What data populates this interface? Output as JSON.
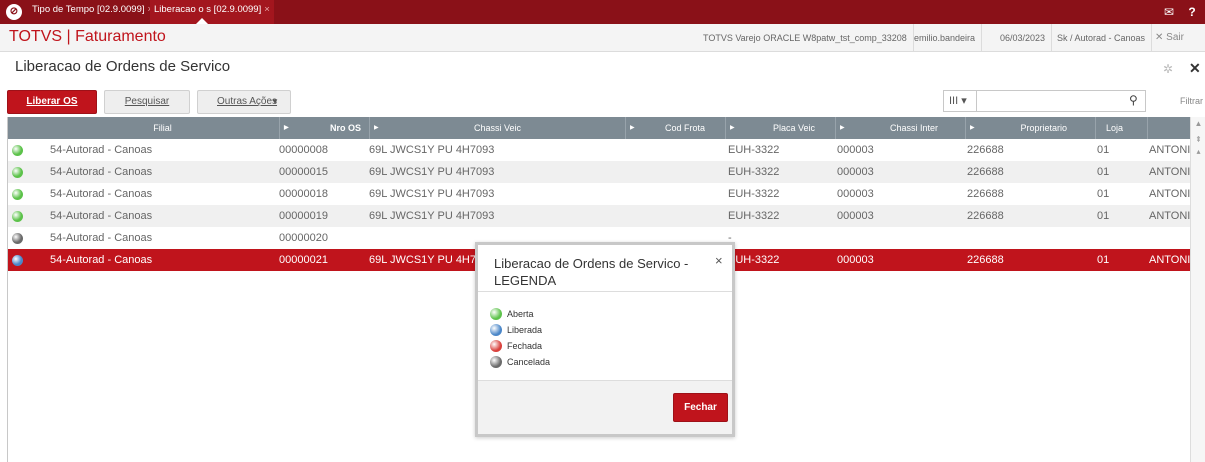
{
  "topbar": {
    "tabs": [
      {
        "label": "Tipo de Tempo [02.9.0099]",
        "close": "×"
      },
      {
        "label": "Liberacao  o s [02.9.0099]",
        "close": "×"
      }
    ],
    "mail_icon": "✉",
    "help_icon": "?"
  },
  "header": {
    "brand": "TOTVS | Faturamento",
    "environment": "TOTVS Varejo ORACLE W8patw_tst_comp_33208",
    "user": "emilio.bandeira",
    "date": "06/03/2023",
    "branch": "Sk / Autorad - Canoas",
    "logout": "✕ Sair"
  },
  "page": {
    "title": "Liberacao de Ordens de Servico"
  },
  "toolbar": {
    "liberar_label": "Liberar OS",
    "pesquisar_label": "Pesquisar",
    "outras_label": "Outras Ações",
    "column_selector": "III ▾",
    "search_value": "",
    "filtrar_label": "Filtrar"
  },
  "grid": {
    "columns": [
      "Filial",
      "Nro OS",
      "Chassi Veic",
      "Cod Frota",
      "Placa Veic",
      "Chassi Inter",
      "Proprietario",
      "Loja",
      ""
    ],
    "rows": [
      {
        "status": "green",
        "filial": "54-Autorad - Canoas",
        "nro_os": "00000008",
        "chassi": "69L JWCS1Y PU 4H7093",
        "cod_frota": "",
        "placa": "EUH-3322",
        "chassi_inter": "000003",
        "proprietario": "226688",
        "loja": "01",
        "nome": "ANTONIO"
      },
      {
        "status": "green",
        "filial": "54-Autorad - Canoas",
        "nro_os": "00000015",
        "chassi": "69L JWCS1Y PU 4H7093",
        "cod_frota": "",
        "placa": "EUH-3322",
        "chassi_inter": "000003",
        "proprietario": "226688",
        "loja": "01",
        "nome": "ANTONIO"
      },
      {
        "status": "green",
        "filial": "54-Autorad - Canoas",
        "nro_os": "00000018",
        "chassi": "69L JWCS1Y PU 4H7093",
        "cod_frota": "",
        "placa": "EUH-3322",
        "chassi_inter": "000003",
        "proprietario": "226688",
        "loja": "01",
        "nome": "ANTONIO"
      },
      {
        "status": "green",
        "filial": "54-Autorad - Canoas",
        "nro_os": "00000019",
        "chassi": "69L JWCS1Y PU 4H7093",
        "cod_frota": "",
        "placa": "EUH-3322",
        "chassi_inter": "000003",
        "proprietario": "226688",
        "loja": "01",
        "nome": "ANTONIO"
      },
      {
        "status": "gray",
        "filial": "54-Autorad - Canoas",
        "nro_os": "00000020",
        "chassi": "",
        "cod_frota": "",
        "placa": "-",
        "chassi_inter": "",
        "proprietario": "",
        "loja": "",
        "nome": ""
      },
      {
        "status": "blue",
        "filial": "54-Autorad - Canoas",
        "nro_os": "00000021",
        "chassi": "69L JWCS1Y PU 4H7",
        "cod_frota": "",
        "placa": "EUH-3322",
        "chassi_inter": "000003",
        "proprietario": "226688",
        "loja": "01",
        "nome": "ANTONIO"
      }
    ]
  },
  "modal": {
    "title": "Liberacao de Ordens de Servico - LEGENDA",
    "close": "×",
    "legend": [
      {
        "label": "Aberta",
        "color": "#5cc24a"
      },
      {
        "label": "Liberada",
        "color": "#4a86c8"
      },
      {
        "label": "Fechada",
        "color": "#d9403b"
      },
      {
        "label": "Cancelada",
        "color": "#6a6a6a"
      }
    ],
    "fechar_label": "Fechar"
  },
  "colors": {
    "brand_red": "#c0141c",
    "topbar": "#8a1118",
    "grid_header": "#7d8a93",
    "status_green": "#5cc24a",
    "status_blue": "#4a86c8",
    "status_gray": "#6a6a6a"
  }
}
